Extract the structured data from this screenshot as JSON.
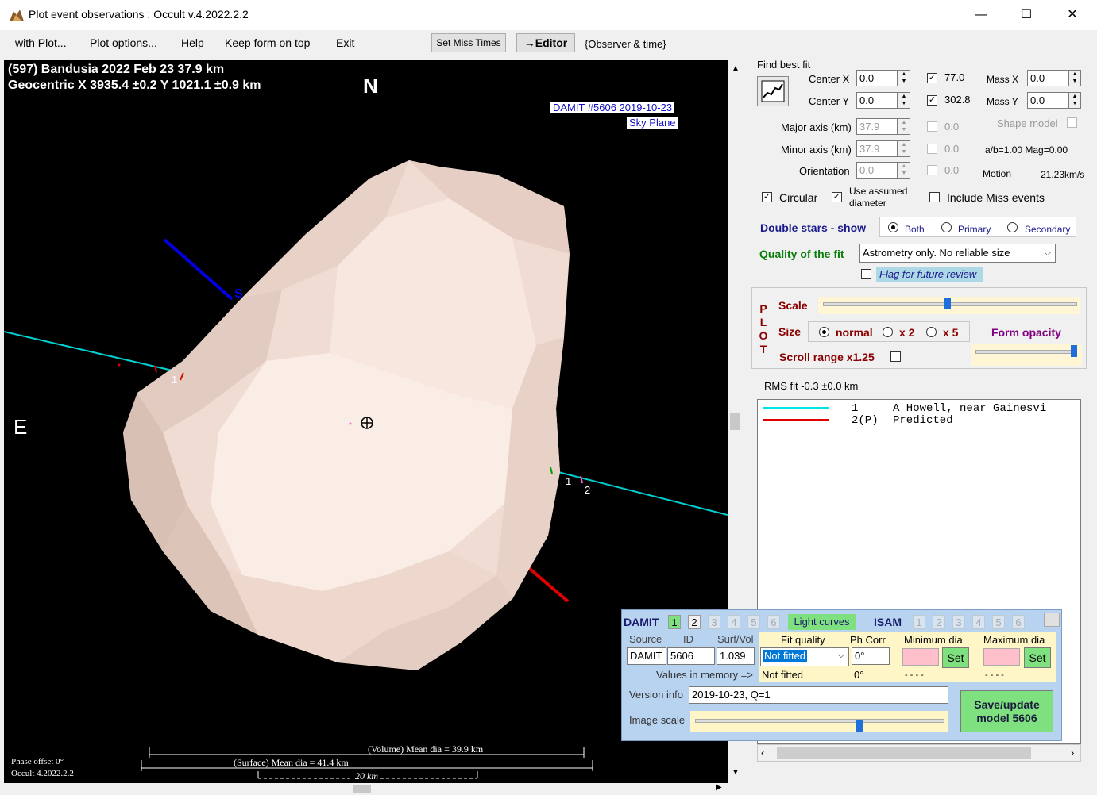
{
  "window": {
    "title": "Plot event observations : Occult v.4.2022.2.2",
    "minimize": "—",
    "maximize": "☐",
    "close": "✕"
  },
  "menu": {
    "items": [
      "with Plot...",
      "Plot options...",
      "Help",
      "Keep form on top",
      "Exit"
    ],
    "set_miss_times": "Set Miss Times",
    "editor": "→Editor",
    "observer_time": "{Observer & time}"
  },
  "plot": {
    "header_line1": "(597) Bandusia  2022 Feb 23   37.9 km",
    "header_line2": "Geocentric  X  3935.4 ±0.2  Y  1021.1 ±0.9 km",
    "north": "N",
    "east": "E",
    "damit_label": "DAMIT #5606 2019-10-23",
    "sky_plane": "Sky Plane",
    "s_label": "S",
    "chord1_left": "1",
    "chord1_right": "1",
    "chord2_right": "2",
    "volume_dia": "(Volume) Mean dia = 39.9 km",
    "surface_dia": "(Surface) Mean dia = 41.4 km",
    "scale_20km": "20 km",
    "phase_offset": "Phase offset 0°",
    "occult_version": "Occult 4.2022.2.2"
  },
  "fit": {
    "find_best_fit": "Find best fit",
    "center_x_label": "Center X",
    "center_x": "0.0",
    "center_y_label": "Center Y",
    "center_y": "0.0",
    "pa_value": "77.0",
    "pa2_value": "302.8",
    "mass_x_label": "Mass X",
    "mass_x": "0.0",
    "mass_y_label": "Mass Y",
    "mass_y": "0.0",
    "major_axis_label": "Major axis (km)",
    "major_axis": "37.9",
    "major_check_val": "0.0",
    "minor_axis_label": "Minor axis (km)",
    "minor_axis": "37.9",
    "minor_check_val": "0.0",
    "orientation_label": "Orientation",
    "orientation": "0.0",
    "orient_check_val": "0.0",
    "shape_model": "Shape model",
    "ab_mag": "a/b=1.00  Mag=0.00",
    "motion_label": "Motion",
    "motion_value": "21.23km/s",
    "circular": "Circular",
    "use_assumed_diameter": "Use assumed diameter",
    "include_miss_events": "Include Miss events",
    "double_stars_show": "Double stars - show",
    "both": "Both",
    "primary": "Primary",
    "secondary": "Secondary",
    "quality_label": "Quality of the fit",
    "quality_value": "Astrometry only. No reliable size",
    "flag_review": "Flag for future review"
  },
  "plot_panel": {
    "plot_vertical": [
      "P",
      "L",
      "O",
      "T"
    ],
    "scale": "Scale",
    "size": "Size",
    "normal": "normal",
    "x2": "x 2",
    "x5": "x 5",
    "form_opacity": "Form opacity",
    "scroll_range": "Scroll range x1.25"
  },
  "rms": "RMS fit -0.3 ±0.0 km",
  "legend": [
    {
      "num": "1",
      "text": "A Howell, near Gainesvi",
      "color": "#00e5e5"
    },
    {
      "num": "2(P)",
      "text": "Predicted",
      "color": "#e00000"
    }
  ],
  "damit": {
    "damit_label": "DAMIT",
    "damit_tabs": [
      "1",
      "2",
      "3",
      "4",
      "5",
      "6"
    ],
    "light_curves": "Light curves",
    "isam_label": "ISAM",
    "isam_tabs": [
      "1",
      "2",
      "3",
      "4",
      "5",
      "6"
    ],
    "source_label": "Source",
    "id_label": "ID",
    "surf_vol_label": "Surf/Vol",
    "fit_quality_label": "Fit quality",
    "ph_corr_label": "Ph Corr",
    "min_dia_label": "Minimum dia",
    "max_dia_label": "Maximum dia",
    "source_value": "DAMIT",
    "id_value": "5606",
    "surf_vol_value": "1.039",
    "fit_quality_value": "Not fitted",
    "ph_corr_value": "0°",
    "set": "Set",
    "values_in_memory": "Values in memory =>",
    "mem_fit": "Not fitted",
    "mem_ph": "0°",
    "mem_min": "- - - -",
    "mem_max": "- - - -",
    "version_info_label": "Version info",
    "version_info_value": "2019-10-23, Q=1",
    "image_scale_label": "Image scale",
    "save_update": "Save/update model 5606"
  }
}
